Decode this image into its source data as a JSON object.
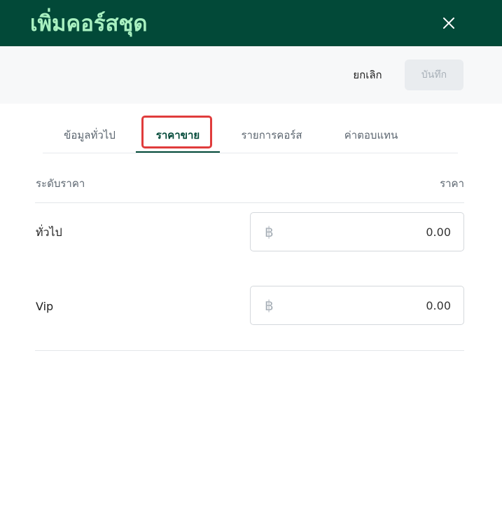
{
  "header": {
    "title": "เพิ่มคอร์สชุด",
    "close_icon": "close-icon"
  },
  "toolbar": {
    "cancel_label": "ยกเลิก",
    "save_label": "บันทึก"
  },
  "tabs": [
    {
      "label": "ข้อมูลทั่วไป"
    },
    {
      "label": "ราคาขาย"
    },
    {
      "label": "รายการคอร์ส"
    },
    {
      "label": "ค่าตอบแทน"
    }
  ],
  "active_tab": "ราคาขาย",
  "table": {
    "headers": {
      "level": "ระดับราคา",
      "price": "ราคา"
    },
    "rows": [
      {
        "label": "ทั่วไป",
        "currency": "฿",
        "value": "0.00"
      },
      {
        "label": "Vip",
        "currency": "฿",
        "value": "0.00"
      }
    ]
  },
  "colors": {
    "header_bg": "#024938",
    "title": "#a8f0c0",
    "highlight": "#e03c3c",
    "active_tab": "#024938"
  }
}
